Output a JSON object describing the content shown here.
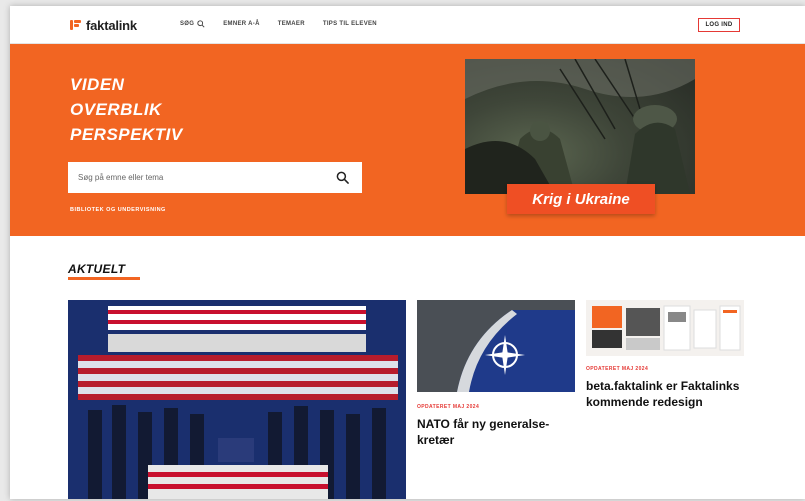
{
  "header": {
    "logo_text": "faktalink",
    "nav": [
      {
        "label": "SØG"
      },
      {
        "label": "EMNER A-Å"
      },
      {
        "label": "TEMAER"
      },
      {
        "label": "TIPS TIL ELEVEN"
      }
    ],
    "login_label": "LOG IND"
  },
  "hero": {
    "tagline": [
      "VIDEN",
      "OVERBLIK",
      "PERSPEKTIV"
    ],
    "search_placeholder": "Søg på emne eller tema",
    "library_link": "BIBLIOTEK OG UNDERVISNING",
    "feature_caption": "Krig i Ukraine"
  },
  "news": {
    "section_title": "AKTUELT",
    "cards": [
      {
        "updated": "",
        "title": ""
      },
      {
        "updated": "OPDATERET MAJ 2024",
        "title": "NATO får ny generalse-kretær"
      },
      {
        "updated": "OPDATERET MAJ 2024",
        "title": "beta.faktalink er Faktalinks kommende redesign"
      }
    ]
  },
  "colors": {
    "brand_orange": "#f26522",
    "caption_red": "#ef4f24",
    "accent_red": "#e53935"
  }
}
